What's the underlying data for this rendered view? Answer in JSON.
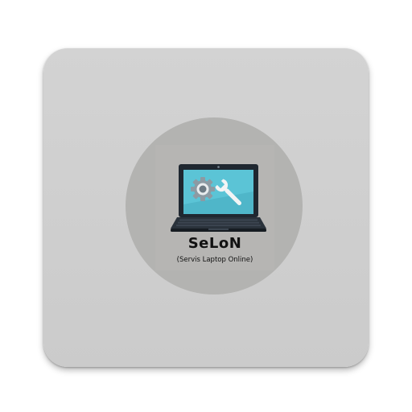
{
  "app": {
    "name": "SeLoN",
    "tagline": "(Servis Laptop Online)"
  },
  "icons": {
    "logo": "laptop-with-gear-and-wrench-icon"
  },
  "colors": {
    "tile_background": "#cfcfcf",
    "emblem_circle": "#b3b3b1",
    "screen_accent": "#5bc4d6",
    "laptop_body": "#1f2730",
    "text": "#111111"
  }
}
